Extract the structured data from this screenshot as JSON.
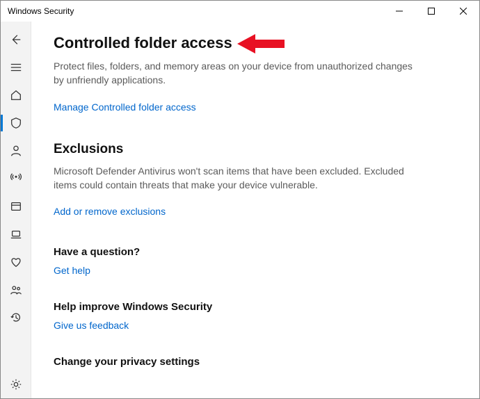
{
  "window": {
    "title": "Windows Security"
  },
  "sidebar": {
    "items": [
      {
        "name": "back"
      },
      {
        "name": "menu"
      },
      {
        "name": "home"
      },
      {
        "name": "virus-protection",
        "selected": true
      },
      {
        "name": "account-protection"
      },
      {
        "name": "firewall-network"
      },
      {
        "name": "app-browser-control"
      },
      {
        "name": "device-security"
      },
      {
        "name": "device-performance"
      },
      {
        "name": "family-options"
      },
      {
        "name": "protection-history"
      }
    ],
    "footer": {
      "name": "settings"
    }
  },
  "sections": {
    "cfa": {
      "heading": "Controlled folder access",
      "desc": "Protect files, folders, and memory areas on your device from unauthorized changes by unfriendly applications.",
      "link": "Manage Controlled folder access"
    },
    "exclusions": {
      "heading": "Exclusions",
      "desc": "Microsoft Defender Antivirus won't scan items that have been excluded. Excluded items could contain threats that make your device vulnerable.",
      "link": "Add or remove exclusions"
    },
    "question": {
      "heading": "Have a question?",
      "link": "Get help"
    },
    "improve": {
      "heading": "Help improve Windows Security",
      "link": "Give us feedback"
    },
    "privacy": {
      "heading": "Change your privacy settings"
    }
  }
}
